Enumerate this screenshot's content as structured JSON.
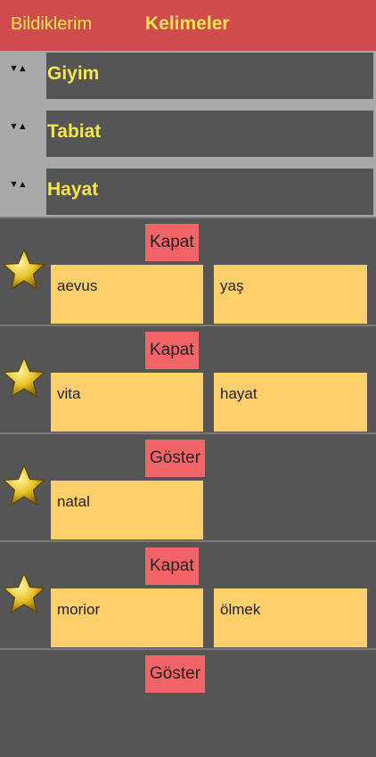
{
  "navbar": {
    "left_label": "Bildiklerim",
    "title": "Kelimeler"
  },
  "categories": [
    {
      "arrows": "▼▲",
      "label": "Giyim"
    },
    {
      "arrows": "▼▲",
      "label": "Tabiat"
    },
    {
      "arrows": "▼▲",
      "label": "Hayat"
    }
  ],
  "words": [
    {
      "button": "Kapat",
      "word": "aevus",
      "meaning": "yaş"
    },
    {
      "button": "Kapat",
      "word": "vita",
      "meaning": "hayat"
    },
    {
      "button": "Göster",
      "word": "natal",
      "meaning": ""
    },
    {
      "button": "Kapat",
      "word": "morior",
      "meaning": "ölmek"
    },
    {
      "button": "Göster",
      "word": "",
      "meaning": ""
    }
  ],
  "colors": {
    "navbar": "#d04b4d",
    "accent_text": "#f5e64a",
    "button": "#f26467",
    "card": "#ffcf6b",
    "background": "#555555"
  },
  "icons": {
    "star": "star-icon",
    "expand": "expand-collapse-icon"
  }
}
